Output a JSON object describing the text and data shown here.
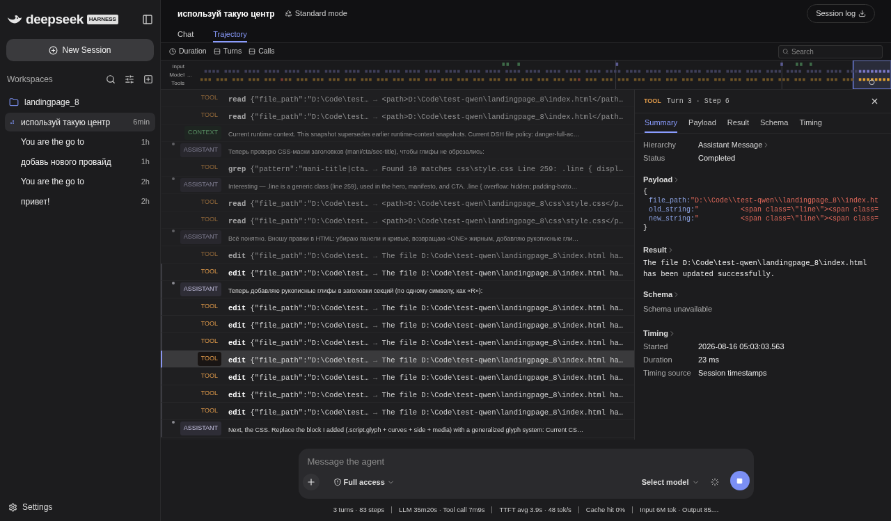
{
  "sidebar": {
    "logo": {
      "name": "deepseek",
      "badge": "HARNESS"
    },
    "new_session": "New Session",
    "workspaces_label": "Workspaces",
    "workspace": "landingpage_8",
    "sessions": [
      {
        "title": "используй такую центр",
        "time": "6min",
        "selected": true,
        "running": true
      },
      {
        "title": "You are the go to",
        "time": "1h",
        "selected": false,
        "running": false
      },
      {
        "title": "добавь нового провайд",
        "time": "1h",
        "selected": false,
        "running": false
      },
      {
        "title": "You are the go to",
        "time": "2h",
        "selected": false,
        "running": false
      },
      {
        "title": "привет!",
        "time": "2h",
        "selected": false,
        "running": false
      }
    ],
    "settings": "Settings"
  },
  "header": {
    "title": "используй такую центр",
    "mode": "Standard mode",
    "session_log": "Session log",
    "tabs": [
      {
        "label": "Chat",
        "selected": false
      },
      {
        "label": "Trajectory",
        "selected": true
      }
    ]
  },
  "toolbar": {
    "items": [
      {
        "label": "Duration",
        "kind": "clock"
      },
      {
        "label": "Turns",
        "kind": "split"
      },
      {
        "label": "Calls",
        "kind": "split"
      }
    ],
    "search_placeholder": "Search"
  },
  "timeline": {
    "labels": [
      "Input",
      "Model",
      "Tools"
    ],
    "more": "..."
  },
  "rows": [
    {
      "kind": "tool",
      "dimmed": true,
      "selected": false,
      "turn_start": false,
      "badge": "TOOL",
      "name": "read",
      "args": "{\"file_path\":\"D:\\Code\\test…",
      "arrow": "→",
      "result": "<path>D:\\Code\\test-qwen\\landingpage_8\\index.html</path…"
    },
    {
      "kind": "tool",
      "dimmed": true,
      "selected": false,
      "turn_start": false,
      "badge": "TOOL",
      "name": "read",
      "args": "{\"file_path\":\"D:\\Code\\test…",
      "arrow": "→",
      "result": "<path>D:\\Code\\test-qwen\\landingpage_8\\index.html</path…"
    },
    {
      "kind": "context",
      "dimmed": true,
      "selected": false,
      "turn_start": false,
      "badge": "CONTEXT",
      "text": "Current runtime context. This snapshot supersedes earlier runtime-context snapshots. Current DSH file policy: danger-full-ac…"
    },
    {
      "kind": "assistant",
      "dimmed": true,
      "selected": false,
      "turn_start": true,
      "badge": "ASSISTANT",
      "text": "Теперь проверю CSS-маски заголовков (mani/cta/sec-title), чтобы глифы не обрезались:"
    },
    {
      "kind": "tool",
      "dimmed": true,
      "selected": false,
      "turn_start": false,
      "badge": "TOOL",
      "name": "grep",
      "args": "{\"pattern\":\"mani-title|cta…",
      "arrow": "→",
      "result": "Found 10 matches css\\style.css Line 259: .line { displ…"
    },
    {
      "kind": "assistant",
      "dimmed": true,
      "selected": false,
      "turn_start": true,
      "badge": "ASSISTANT",
      "text": "Interesting — .line is a generic class (line 259), used in the hero, manifesto, and CTA. .line { overflow: hidden; padding-botto…"
    },
    {
      "kind": "tool",
      "dimmed": true,
      "selected": false,
      "turn_start": false,
      "badge": "TOOL",
      "name": "read",
      "args": "{\"file_path\":\"D:\\Code\\test…",
      "arrow": "→",
      "result": "<path>D:\\Code\\test-qwen\\landingpage_8\\css\\style.css</p…"
    },
    {
      "kind": "tool",
      "dimmed": true,
      "selected": false,
      "turn_start": false,
      "badge": "TOOL",
      "name": "read",
      "args": "{\"file_path\":\"D:\\Code\\test…",
      "arrow": "→",
      "result": "<path>D:\\Code\\test-qwen\\landingpage_8\\css\\style.css</p…"
    },
    {
      "kind": "assistant",
      "dimmed": true,
      "selected": false,
      "turn_start": true,
      "badge": "ASSISTANT",
      "text": "Всё понятно. Вношу правки в HTML: убираю панели и кривые, возвращаю «ONE» жирным, добавляю рукописные гли…"
    },
    {
      "kind": "tool",
      "dimmed": true,
      "selected": false,
      "turn_start": false,
      "badge": "TOOL",
      "name": "edit",
      "args": "{\"file_path\":\"D:\\Code\\test…",
      "arrow": "→",
      "result": "The file D:\\Code\\test-qwen\\landingpage_8\\index.html ha…"
    },
    {
      "kind": "tool",
      "dimmed": false,
      "selected": false,
      "turn_start": false,
      "badge": "TOOL",
      "name": "edit",
      "args": "{\"file_path\":\"D:\\Code\\test…",
      "arrow": "→",
      "result": "The file D:\\Code\\test-qwen\\landingpage_8\\index.html ha…"
    },
    {
      "kind": "assistant",
      "dimmed": false,
      "selected": false,
      "turn_start": true,
      "badge": "ASSISTANT",
      "text": "Теперь добавляю рукописные глифы в заголовки секций (по одному символу, как «R»):"
    },
    {
      "kind": "tool",
      "dimmed": false,
      "selected": false,
      "turn_start": false,
      "badge": "TOOL",
      "name": "edit",
      "args": "{\"file_path\":\"D:\\Code\\test…",
      "arrow": "→",
      "result": "The file D:\\Code\\test-qwen\\landingpage_8\\index.html ha…"
    },
    {
      "kind": "tool",
      "dimmed": false,
      "selected": false,
      "turn_start": false,
      "badge": "TOOL",
      "name": "edit",
      "args": "{\"file_path\":\"D:\\Code\\test…",
      "arrow": "→",
      "result": "The file D:\\Code\\test-qwen\\landingpage_8\\index.html ha…"
    },
    {
      "kind": "tool",
      "dimmed": false,
      "selected": false,
      "turn_start": false,
      "badge": "TOOL",
      "name": "edit",
      "args": "{\"file_path\":\"D:\\Code\\test…",
      "arrow": "→",
      "result": "The file D:\\Code\\test-qwen\\landingpage_8\\index.html ha…"
    },
    {
      "kind": "tool",
      "dimmed": false,
      "selected": true,
      "turn_start": false,
      "badge": "TOOL",
      "name": "edit",
      "args": "{\"file_path\":\"D:\\Code\\test…",
      "arrow": "→",
      "result": "The file D:\\Code\\test-qwen\\landingpage_8\\index.html ha…"
    },
    {
      "kind": "tool",
      "dimmed": false,
      "selected": false,
      "turn_start": false,
      "badge": "TOOL",
      "name": "edit",
      "args": "{\"file_path\":\"D:\\Code\\test…",
      "arrow": "→",
      "result": "The file D:\\Code\\test-qwen\\landingpage_8\\index.html ha…"
    },
    {
      "kind": "tool",
      "dimmed": false,
      "selected": false,
      "turn_start": false,
      "badge": "TOOL",
      "name": "edit",
      "args": "{\"file_path\":\"D:\\Code\\test…",
      "arrow": "→",
      "result": "The file D:\\Code\\test-qwen\\landingpage_8\\index.html ha…"
    },
    {
      "kind": "tool",
      "dimmed": false,
      "selected": false,
      "turn_start": false,
      "badge": "TOOL",
      "name": "edit",
      "args": "{\"file_path\":\"D:\\Code\\test…",
      "arrow": "→",
      "result": "The file D:\\Code\\test-qwen\\landingpage_8\\index.html ha…"
    },
    {
      "kind": "assistant",
      "dimmed": false,
      "selected": false,
      "turn_start": true,
      "badge": "ASSISTANT",
      "text": "Next, the CSS. Replace the block I added (.script.glyph + curves + side + media) with a generalized glyph system: Current CS…"
    }
  ],
  "detail": {
    "badge": "TOOL",
    "subtitle": "Turn 3 · Step 6",
    "tabs": [
      {
        "label": "Summary",
        "selected": true
      },
      {
        "label": "Payload",
        "selected": false
      },
      {
        "label": "Result",
        "selected": false
      },
      {
        "label": "Schema",
        "selected": false
      },
      {
        "label": "Timing",
        "selected": false
      }
    ],
    "summary": [
      {
        "label": "Hierarchy",
        "value": "Assistant Message",
        "link": true
      },
      {
        "label": "Status",
        "value": "Completed",
        "link": false
      }
    ],
    "payload": {
      "title": "Payload",
      "open": "{",
      "close": "}",
      "fields": [
        {
          "key": "file_path:",
          "value": "\"D:\\\\Code\\\\test-qwen\\\\landingpage_8\\\\index.ht"
        },
        {
          "key": "old_string:",
          "value": "\"          <span class=\\\"line\\\"><span class="
        },
        {
          "key": "new_string:",
          "value": "\"          <span class=\\\"line\\\"><span class="
        }
      ]
    },
    "result": {
      "title": "Result",
      "lines": [
        "The file D:\\Code\\test-qwen\\landingpage_8\\index.html",
        "has been updated successfully."
      ]
    },
    "schema": {
      "title": "Schema",
      "text": "Schema unavailable"
    },
    "timing": {
      "title": "Timing",
      "fields": [
        {
          "label": "Started",
          "value": "2026-08-16 05:03:03.563"
        },
        {
          "label": "Duration",
          "value": "23 ms"
        },
        {
          "label": "Timing source",
          "value": "Session timestamps"
        }
      ]
    }
  },
  "composer": {
    "placeholder": "Message the agent",
    "access": "Full access",
    "model": "Select model",
    "busy": true
  },
  "status_bar": [
    "3 turns · 83 steps",
    "LLM 35m20s · Tool call 7m9s",
    "TTFT avg 3.9s · 48 tok/s",
    "Cache hit 0%",
    "Input 6M tok · Output 85...."
  ]
}
